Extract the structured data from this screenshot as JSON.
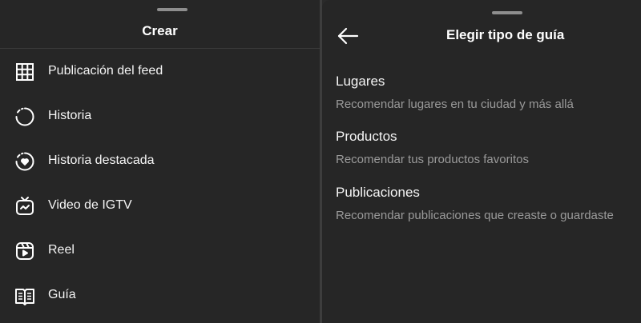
{
  "create_sheet": {
    "title": "Crear",
    "items": [
      {
        "label": "Publicación del feed",
        "icon": "grid-icon"
      },
      {
        "label": "Historia",
        "icon": "story-ring-icon"
      },
      {
        "label": "Historia destacada",
        "icon": "highlight-heart-icon"
      },
      {
        "label": "Video de IGTV",
        "icon": "igtv-icon"
      },
      {
        "label": "Reel",
        "icon": "reel-icon"
      },
      {
        "label": "Guía",
        "icon": "guide-book-icon"
      }
    ]
  },
  "guide_type_sheet": {
    "title": "Elegir tipo de guía",
    "back_icon": "arrow-left-icon",
    "options": [
      {
        "title": "Lugares",
        "description": "Recomendar lugares en tu ciudad y más allá"
      },
      {
        "title": "Productos",
        "description": "Recomendar tus productos favoritos"
      },
      {
        "title": "Publicaciones",
        "description": "Recomendar publicaciones que creaste o guardaste"
      }
    ]
  },
  "colors": {
    "background": "#262626",
    "text_primary": "#f5f5f5",
    "text_secondary": "#9a9a9a"
  }
}
